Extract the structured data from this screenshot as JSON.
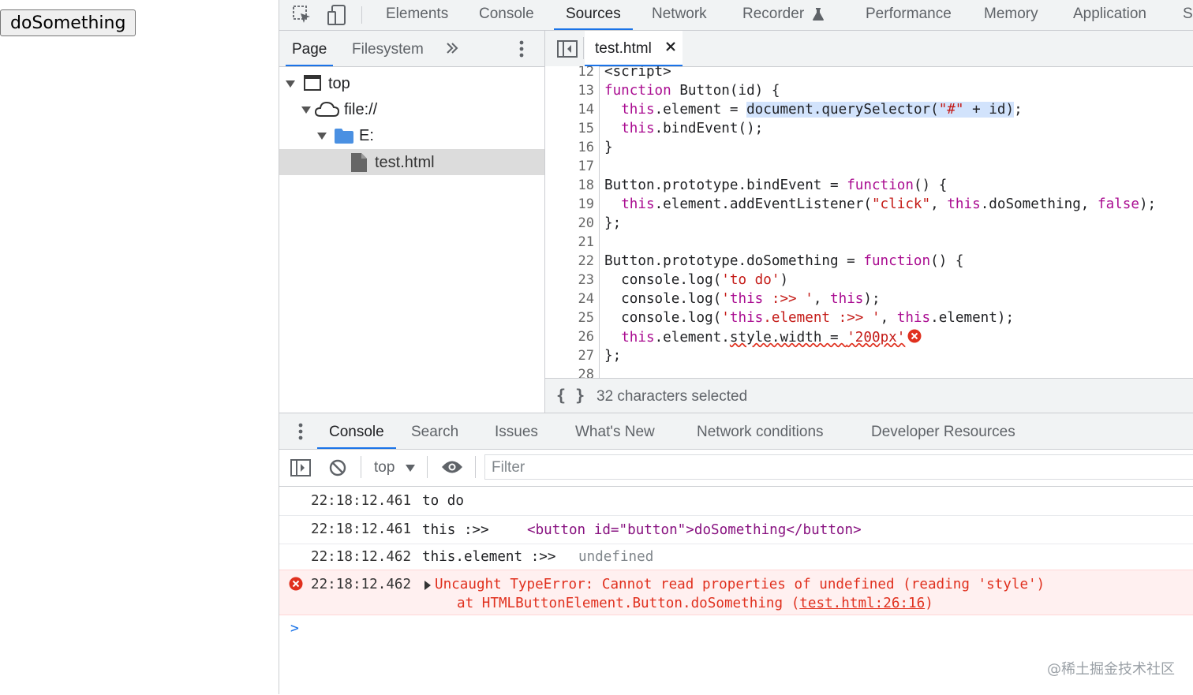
{
  "page": {
    "button_label": "doSomething"
  },
  "devtools": {
    "main_tabs": [
      "Elements",
      "Console",
      "Sources",
      "Network",
      "Recorder",
      "Performance",
      "Memory",
      "Application",
      "Se"
    ],
    "active_main_tab": "Sources",
    "navigator": {
      "tabs": [
        "Page",
        "Filesystem"
      ],
      "active_tab": "Page",
      "tree": [
        {
          "label": "top",
          "type": "frame",
          "depth": 0,
          "expanded": true
        },
        {
          "label": "file://",
          "type": "origin",
          "depth": 1,
          "expanded": true
        },
        {
          "label": "E:",
          "type": "folder",
          "depth": 2,
          "expanded": true
        },
        {
          "label": "test.html",
          "type": "file",
          "depth": 3,
          "selected": true
        }
      ]
    },
    "editor": {
      "open_file": "test.html",
      "lines": [
        {
          "n": "12",
          "text": "<script>"
        },
        {
          "n": "13",
          "text": "function Button(id) {"
        },
        {
          "n": "14",
          "text": "  this.element = document.querySelector(\"#\" + id);"
        },
        {
          "n": "15",
          "text": "  this.bindEvent();"
        },
        {
          "n": "16",
          "text": "}"
        },
        {
          "n": "17",
          "text": ""
        },
        {
          "n": "18",
          "text": "Button.prototype.bindEvent = function() {"
        },
        {
          "n": "19",
          "text": "  this.element.addEventListener(\"click\", this.doSomething, false);"
        },
        {
          "n": "20",
          "text": "};"
        },
        {
          "n": "21",
          "text": ""
        },
        {
          "n": "22",
          "text": "Button.prototype.doSomething = function() {"
        },
        {
          "n": "23",
          "text": "  console.log('to do')"
        },
        {
          "n": "24",
          "text": "  console.log('this :>> ', this);"
        },
        {
          "n": "25",
          "text": "  console.log('this.element :>> ', this.element);"
        },
        {
          "n": "26",
          "text": "  this.element.style.width = '200px'"
        },
        {
          "n": "27",
          "text": "};"
        },
        {
          "n": "28",
          "text": ""
        }
      ],
      "status": "32 characters selected",
      "pretty_print": "{ }"
    },
    "drawer": {
      "tabs": [
        "Console",
        "Search",
        "Issues",
        "What's New",
        "Network conditions",
        "Developer Resources"
      ],
      "active_tab": "Console",
      "context": "top",
      "filter_placeholder": "Filter",
      "messages": [
        {
          "time": "22:18:12.461",
          "text": "to do"
        },
        {
          "time": "22:18:12.461",
          "text": "this :>>",
          "value": "<button id=\"button\">doSomething</button>"
        },
        {
          "time": "22:18:12.462",
          "text": "this.element :>>",
          "value": "undefined"
        },
        {
          "time": "22:18:12.462",
          "level": "error",
          "text": "Uncaught TypeError: Cannot read properties of undefined (reading 'style')",
          "stack_prefix": "at HTMLButtonElement.Button.doSomething (",
          "stack_link": "test.html:26:16",
          "stack_suffix": ")"
        }
      ],
      "prompt": ">"
    },
    "watermark": "@稀土掘金技术社区"
  },
  "colors": {
    "accent": "#1a73e8",
    "error": "#e0301e",
    "keyword": "#aa0d91",
    "string": "#c41a16"
  }
}
